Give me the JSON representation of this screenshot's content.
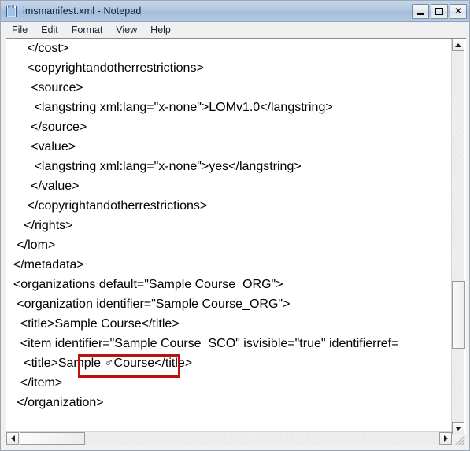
{
  "window": {
    "title": "imsmanifest.xml - Notepad",
    "icon": "notepad-icon",
    "caption_buttons": [
      {
        "name": "minimize",
        "label": "_"
      },
      {
        "name": "maximize",
        "label": "□"
      },
      {
        "name": "close",
        "label": "✕"
      }
    ],
    "colors": {
      "titlebar": "#a5bdda",
      "highlight_border": "#bb1111",
      "text": "#000000",
      "window_background": "#f0f0f0",
      "client_background": "#ffffff"
    }
  },
  "menubar": {
    "items": [
      {
        "label": "File"
      },
      {
        "label": "Edit"
      },
      {
        "label": "Format"
      },
      {
        "label": "View"
      },
      {
        "label": "Help"
      }
    ]
  },
  "editor": {
    "lines": [
      "      </cost>",
      "      <copyrightandotherrestrictions>",
      "       <source>",
      "        <langstring xml:lang=\"x-none\">LOMv1.0</langstring>",
      "       </source>",
      "       <value>",
      "        <langstring xml:lang=\"x-none\">yes</langstring>",
      "       </value>",
      "      </copyrightandotherrestrictions>",
      "     </rights>",
      "   </lom>",
      "  </metadata>",
      "  <organizations default=\"Sample Course_ORG\">",
      "   <organization identifier=\"Sample Course_ORG\">",
      "    <title>Sample Course</title>",
      "    <item identifier=\"Sample Course_SCO\" isvisible=\"true\" identifierref=",
      "     <title>Sample ♂Course</title>",
      "    </item>",
      "   </organization>"
    ],
    "highlighted_text": "Sample ♂Course",
    "highlight_line_index": 16
  },
  "scrollbars": {
    "vertical": {
      "up_arrow": "scroll-up-arrow",
      "down_arrow": "scroll-down-arrow",
      "thumb_top_pct": 61,
      "thumb_height_pct": 17
    },
    "horizontal": {
      "left_arrow": "scroll-left-arrow",
      "right_arrow": "scroll-right-arrow",
      "thumb_left_pct": 3,
      "thumb_width_pct": 36
    }
  }
}
